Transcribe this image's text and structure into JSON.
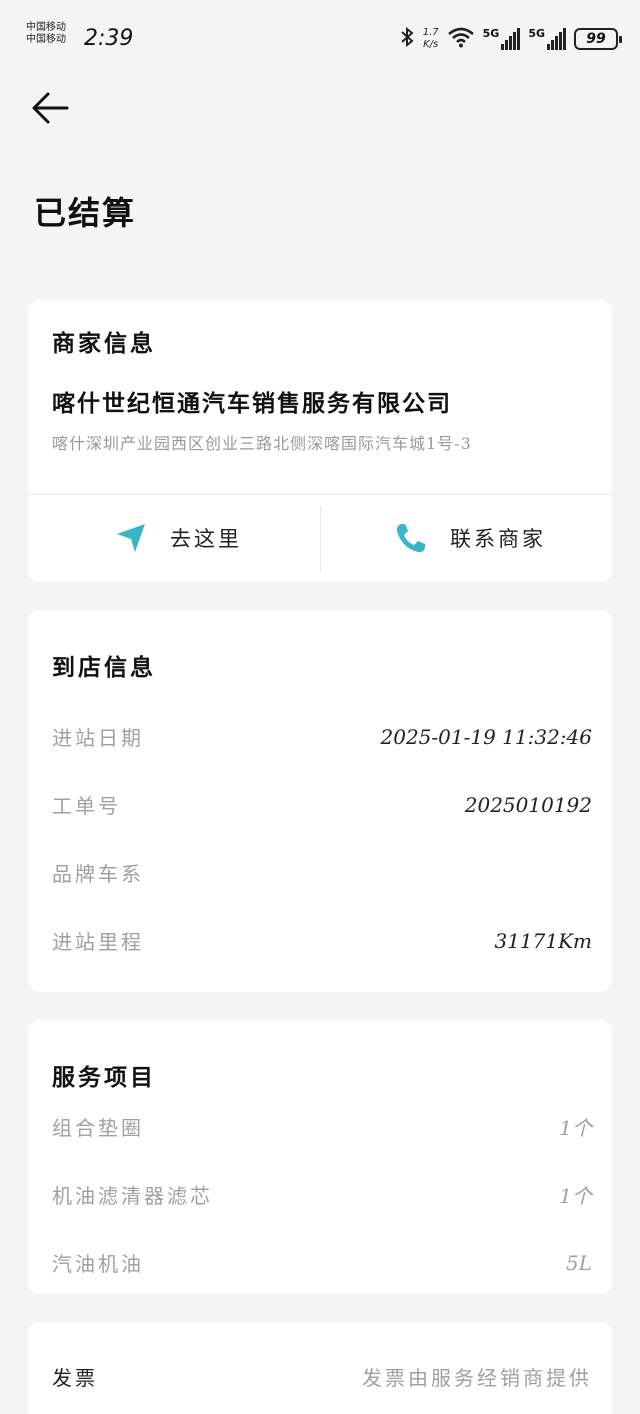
{
  "status_bar": {
    "carrier_1": "中国移动",
    "carrier_2": "中国移动",
    "time": "2:39",
    "net_speed_value": "1.7",
    "net_speed_unit": "K/s",
    "signal_1_label": "5G",
    "signal_2_label": "5G",
    "battery": "99"
  },
  "header": {
    "title": "已结算"
  },
  "merchant": {
    "section_title": "商家信息",
    "name": "喀什世纪恒通汽车销售服务有限公司",
    "address": "喀什深圳产业园西区创业三路北侧深喀国际汽车城1号-3",
    "navigate_label": "去这里",
    "contact_label": "联系商家",
    "accent_color": "#3ab5c8"
  },
  "arrival": {
    "section_title": "到店信息",
    "rows": [
      {
        "label": "进站日期",
        "value": "2025-01-19 11:32:46"
      },
      {
        "label": "工单号",
        "value": "2025010192"
      },
      {
        "label": "品牌车系",
        "value": ""
      },
      {
        "label": "进站里程",
        "value": "31171Km"
      }
    ]
  },
  "services": {
    "section_title": "服务项目",
    "rows": [
      {
        "label": "组合垫圈",
        "value": "1个"
      },
      {
        "label": "机油滤清器滤芯",
        "value": "1个"
      },
      {
        "label": "汽油机油",
        "value": "5L"
      }
    ]
  },
  "invoice": {
    "label": "发票",
    "value": "发票由服务经销商提供"
  }
}
